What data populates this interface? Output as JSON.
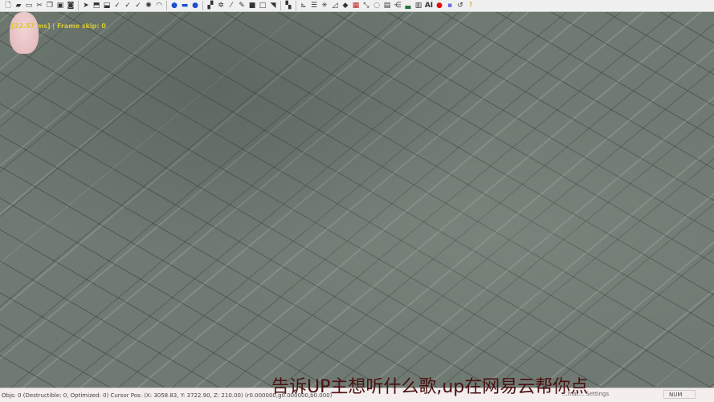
{
  "toolbar": {
    "icons": [
      "new-file",
      "open",
      "open-recent",
      "cut",
      "copy",
      "paste",
      "import",
      "select",
      "select-group",
      "select-plus",
      "check",
      "check-2",
      "check-3",
      "light",
      "camera",
      "globe-blue",
      "tile-blue",
      "sphere-blue",
      "checker",
      "pattern",
      "eyedropper",
      "brush",
      "square-fill",
      "square-outline",
      "corner",
      "layers",
      "axis",
      "lines",
      "tree",
      "triangle",
      "object",
      "grid-red",
      "path",
      "lasso",
      "bsr",
      "branch",
      "terrain",
      "zone",
      "AI",
      "record",
      "region",
      "undo",
      "help"
    ]
  },
  "overlay": {
    "text": "[22.57 ms] | Frame skip: 0",
    "color": "#d8c830"
  },
  "status": {
    "left": "Objs: 0 (Destructible: 0, Optimized: 0) Cursor Pos: (X: 3058.83, Y: 3722.90, Z: 210.00) (r0.000000,g0.000000,b0.000)",
    "mid": "...mat... Settings",
    "num": "NUM"
  },
  "subtitle": "告诉UP主想听什么歌,up在网易云帮你点"
}
